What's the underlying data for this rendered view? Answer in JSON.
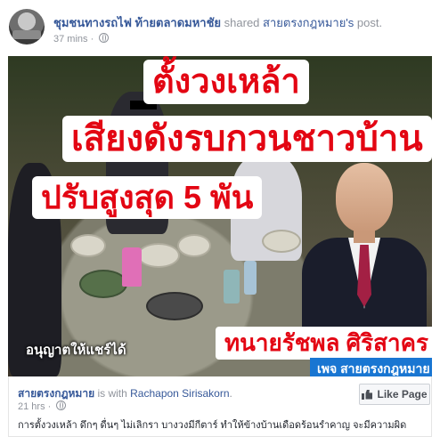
{
  "post_header": {
    "page_name": "ชุมชนทางรถไฟ ท้ายตลาดมหาชัย",
    "shared_text": " shared ",
    "original_owner": "สายตรงกฎหมาย's",
    "post_word": " post.",
    "timestamp": "37 mins",
    "separator": "·"
  },
  "image": {
    "headline1": "ตั้งวงเหล้า",
    "headline2": "เสียงดังรบกวนชาวบ้าน",
    "headline3": "ปรับสูงสุด 5 พัน",
    "permission_text": "อนุญาตให้แชร์ได้",
    "lawyer_name": "ทนายรัชพล  ศิริสาคร",
    "page_badge": "เพจ สายตรงกฎหมาย"
  },
  "shared_post": {
    "page_name": "สายตรงกฎหมาย",
    "with_text": " is with ",
    "tagged_person": "Rachapon Sirisakorn",
    "period": ".",
    "timestamp": "21 hrs",
    "separator": "·",
    "caption": "การตั้งวงเหล้า ดึกๆ ดื่นๆ ไม่เลิกรา บางวงมีกีตาร์ ทำให้ข้างบ้านเดือดร้อนรำคาญ จะมีความผิด",
    "like_button_label": "Like Page"
  },
  "colors": {
    "link": "#365899",
    "meta": "#90949c",
    "headline_red": "#e30613",
    "badge_blue": "#1976d2"
  }
}
